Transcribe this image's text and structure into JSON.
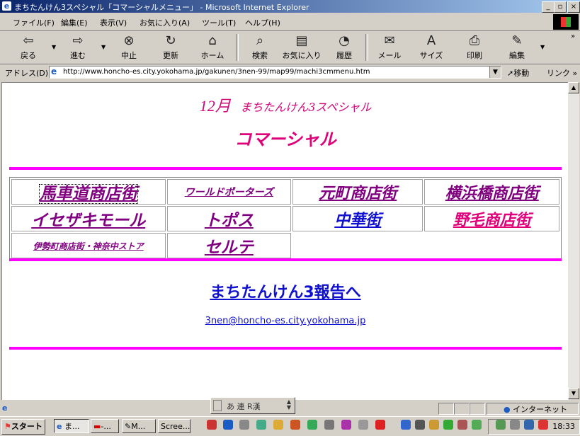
{
  "window": {
    "title": "まちたんけん3スペシャル「コマーシャルメニュー」 - Microsoft Internet Explorer",
    "minimize": "_",
    "maximize": "▫",
    "close": "×"
  },
  "menu": [
    "ファイル(F)",
    "編集(E)",
    "表示(V)",
    "お気に入り(A)",
    "ツール(T)",
    "ヘルプ(H)"
  ],
  "toolbar": {
    "back": "戻る",
    "forward": "進む",
    "stop": "中止",
    "refresh": "更新",
    "home": "ホーム",
    "search": "検索",
    "favorites": "お気に入り",
    "history": "履歴",
    "mail": "メール",
    "size": "サイズ",
    "print": "印刷",
    "edit": "編集"
  },
  "address": {
    "label": "アドレス(D)",
    "url": "http://www.honcho-es.city.yokohama.jp/gakunen/3nen-99/map99/machi3cmmenu.htm",
    "go": "移動",
    "links": "リンク"
  },
  "page": {
    "month": "12月",
    "subtitle": "まちたんけん3スペシャル",
    "heading": "コマーシャル",
    "links": [
      {
        "label": "馬車道商店街",
        "color": "#800080"
      },
      {
        "label": "ワールドポーターズ",
        "color": "#800080"
      },
      {
        "label": "元町商店街",
        "color": "#800080"
      },
      {
        "label": "横浜橋商店街",
        "color": "#800080"
      },
      {
        "label": "イセザキモール",
        "color": "#800080"
      },
      {
        "label": "トポス",
        "color": "#800080"
      },
      {
        "label": "中華街",
        "color": "#1010d0"
      },
      {
        "label": "野毛商店街",
        "color": "#e0007a"
      },
      {
        "label": "伊勢町商店街・神奈中ストア",
        "color": "#800080"
      },
      {
        "label": "セルテ",
        "color": "#800080"
      }
    ],
    "report_link": "まちたんけん3報告へ",
    "email": "3nen@honcho-es.city.yokohama.jp",
    "accent_color": "#ff00ff"
  },
  "ime": {
    "text": "あ 連 R漢"
  },
  "status": {
    "zone": "インターネット"
  },
  "taskbar": {
    "start": "スタート",
    "tasks": [
      "ま...",
      "-...",
      "M...",
      "Scree..."
    ],
    "clock": "18:33"
  },
  "icons": {
    "back": "back-arrow-icon",
    "forward": "forward-arrow-icon",
    "stop": "stop-icon",
    "refresh": "refresh-icon",
    "home": "home-icon",
    "search": "search-icon",
    "favorites": "favorites-icon",
    "history": "history-icon",
    "mail": "mail-icon",
    "size": "font-size-icon",
    "print": "printer-icon",
    "edit": "edit-icon"
  }
}
